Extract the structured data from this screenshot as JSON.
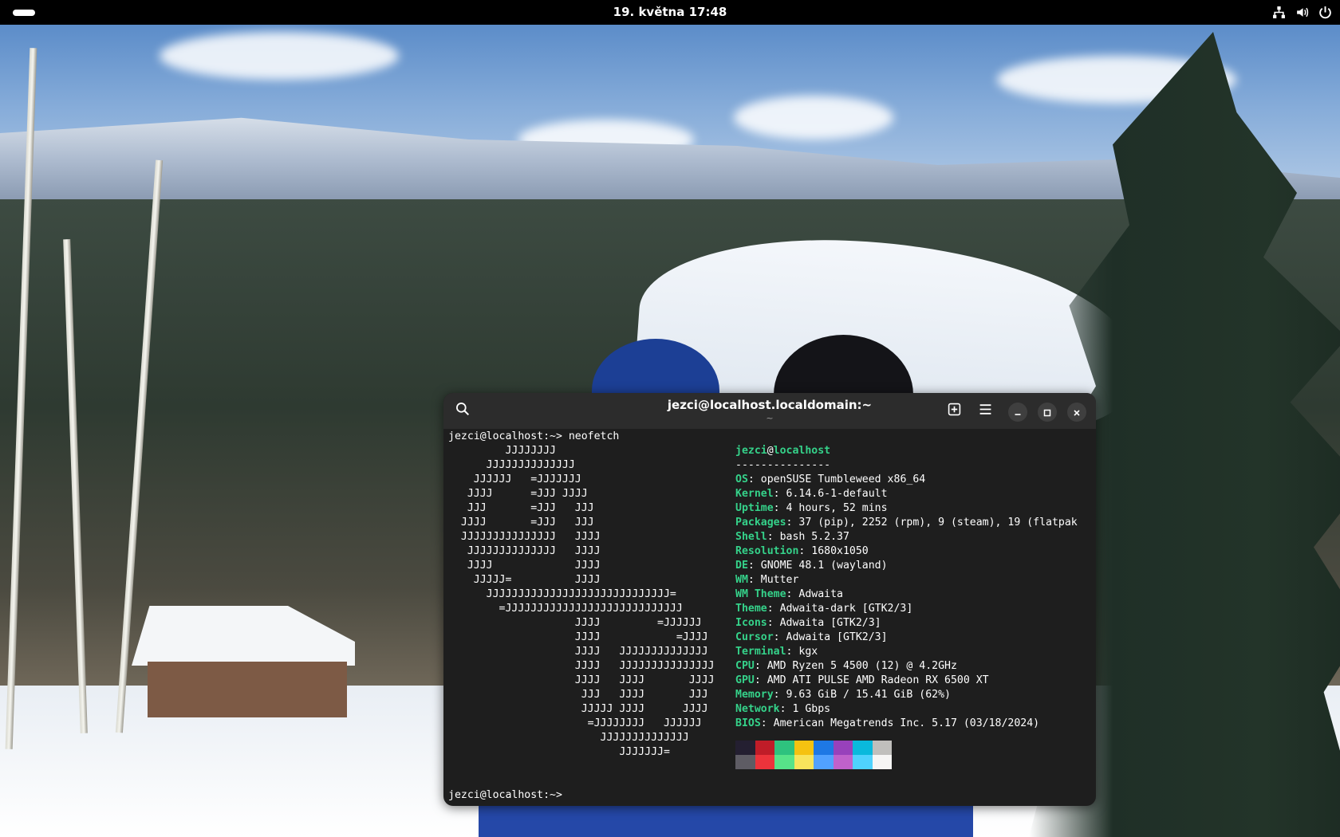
{
  "topbar": {
    "clock": "19. května  17:48",
    "tray_icons": [
      "network-wired-icon",
      "volume-icon",
      "power-icon"
    ]
  },
  "terminal": {
    "title": "jezci@localhost.localdomain:~",
    "subtitle": "~",
    "header_buttons": [
      "search-icon",
      "new-tab-icon",
      "menu-icon",
      "minimize-icon",
      "maximize-icon",
      "close-icon"
    ],
    "command_line": "jezci@localhost:~> neofetch",
    "prompt_line": "jezci@localhost:~>",
    "logo": "         JJJJJJJJ\n      JJJJJJJJJJJJJJ\n    JJJJJJ   =JJJJJJJ\n   JJJJ      =JJJ JJJJ\n   JJJ       =JJJ   JJJ\n  JJJJ       =JJJ   JJJ\n  JJJJJJJJJJJJJJJ   JJJJ\n   JJJJJJJJJJJJJJ   JJJJ\n   JJJJ             JJJJ\n    JJJJJ=          JJJJ\n      JJJJJJJJJJJJJJJJJJJJJJJJJJJJJ=\n        =JJJJJJJJJJJJJJJJJJJJJJJJJJJJ\n                    JJJJ         =JJJJJJ\n                    JJJJ            =JJJJ\n                    JJJJ   JJJJJJJJJJJJJJ\n                    JJJJ   JJJJJJJJJJJJJJJ\n                    JJJJ   JJJJ       JJJJ\n                     JJJ   JJJJ       JJJ\n                     JJJJJ JJJJ      JJJJ\n                      =JJJJJJJJ   JJJJJJ\n                        JJJJJJJJJJJJJJ\n                           JJJJJJJ=",
    "user": "jezci",
    "at": "@",
    "host": "localhost",
    "separator": "---------------",
    "info": [
      {
        "key": "OS",
        "value": ": openSUSE Tumbleweed x86_64"
      },
      {
        "key": "Kernel",
        "value": ": 6.14.6-1-default"
      },
      {
        "key": "Uptime",
        "value": ": 4 hours, 52 mins"
      },
      {
        "key": "Packages",
        "value": ": 37 (pip), 2252 (rpm), 9 (steam), 19 (flatpak"
      },
      {
        "key": "Shell",
        "value": ": bash 5.2.37"
      },
      {
        "key": "Resolution",
        "value": ": 1680x1050"
      },
      {
        "key": "DE",
        "value": ": GNOME 48.1 (wayland)"
      },
      {
        "key": "WM",
        "value": ": Mutter"
      },
      {
        "key": "WM Theme",
        "value": ": Adwaita"
      },
      {
        "key": "Theme",
        "value": ": Adwaita-dark [GTK2/3]"
      },
      {
        "key": "Icons",
        "value": ": Adwaita [GTK2/3]"
      },
      {
        "key": "Cursor",
        "value": ": Adwaita [GTK2/3]"
      },
      {
        "key": "Terminal",
        "value": ": kgx"
      },
      {
        "key": "CPU",
        "value": ": AMD Ryzen 5 4500 (12) @ 4.2GHz"
      },
      {
        "key": "GPU",
        "value": ": AMD ATI PULSE AMD Radeon RX 6500 XT"
      },
      {
        "key": "Memory",
        "value": ": 9.63 GiB / 15.41 GiB (62%)"
      },
      {
        "key": "Network",
        "value": ": 1 Gbps"
      },
      {
        "key": "BIOS",
        "value": ": American Megatrends Inc. 5.17 (03/18/2024)"
      }
    ],
    "palette_dark": [
      "#241f31",
      "#c01c28",
      "#2ec27e",
      "#f5c211",
      "#1e78e4",
      "#9841bb",
      "#0ab9dc",
      "#c0bfbc"
    ],
    "palette_bright": [
      "#5e5c64",
      "#ed333b",
      "#57e389",
      "#f8e45c",
      "#51a1ff",
      "#c061cb",
      "#4fd2fd",
      "#f6f5f4"
    ],
    "accent": "#35d28a"
  }
}
